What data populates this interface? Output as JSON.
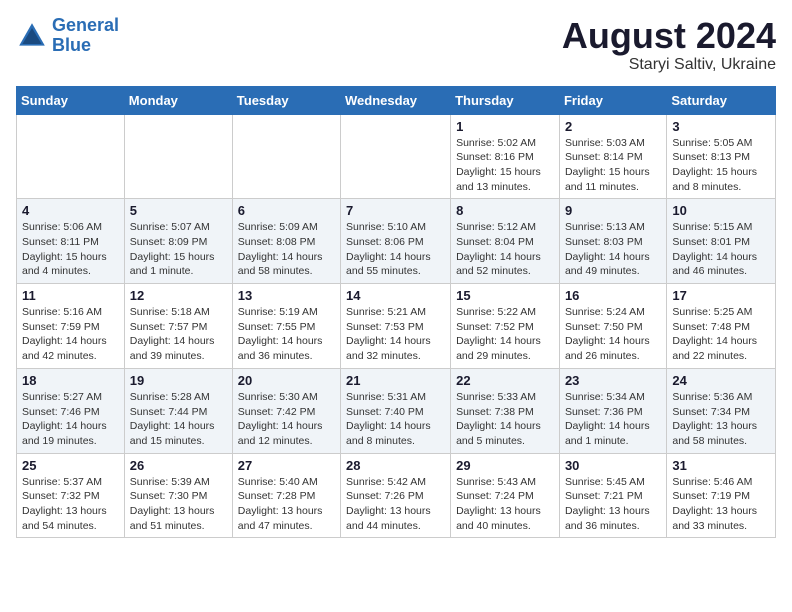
{
  "header": {
    "logo_line1": "General",
    "logo_line2": "Blue",
    "month": "August 2024",
    "location": "Staryi Saltiv, Ukraine"
  },
  "weekdays": [
    "Sunday",
    "Monday",
    "Tuesday",
    "Wednesday",
    "Thursday",
    "Friday",
    "Saturday"
  ],
  "weeks": [
    [
      {
        "day": "",
        "info": ""
      },
      {
        "day": "",
        "info": ""
      },
      {
        "day": "",
        "info": ""
      },
      {
        "day": "",
        "info": ""
      },
      {
        "day": "1",
        "info": "Sunrise: 5:02 AM\nSunset: 8:16 PM\nDaylight: 15 hours\nand 13 minutes."
      },
      {
        "day": "2",
        "info": "Sunrise: 5:03 AM\nSunset: 8:14 PM\nDaylight: 15 hours\nand 11 minutes."
      },
      {
        "day": "3",
        "info": "Sunrise: 5:05 AM\nSunset: 8:13 PM\nDaylight: 15 hours\nand 8 minutes."
      }
    ],
    [
      {
        "day": "4",
        "info": "Sunrise: 5:06 AM\nSunset: 8:11 PM\nDaylight: 15 hours\nand 4 minutes."
      },
      {
        "day": "5",
        "info": "Sunrise: 5:07 AM\nSunset: 8:09 PM\nDaylight: 15 hours\nand 1 minute."
      },
      {
        "day": "6",
        "info": "Sunrise: 5:09 AM\nSunset: 8:08 PM\nDaylight: 14 hours\nand 58 minutes."
      },
      {
        "day": "7",
        "info": "Sunrise: 5:10 AM\nSunset: 8:06 PM\nDaylight: 14 hours\nand 55 minutes."
      },
      {
        "day": "8",
        "info": "Sunrise: 5:12 AM\nSunset: 8:04 PM\nDaylight: 14 hours\nand 52 minutes."
      },
      {
        "day": "9",
        "info": "Sunrise: 5:13 AM\nSunset: 8:03 PM\nDaylight: 14 hours\nand 49 minutes."
      },
      {
        "day": "10",
        "info": "Sunrise: 5:15 AM\nSunset: 8:01 PM\nDaylight: 14 hours\nand 46 minutes."
      }
    ],
    [
      {
        "day": "11",
        "info": "Sunrise: 5:16 AM\nSunset: 7:59 PM\nDaylight: 14 hours\nand 42 minutes."
      },
      {
        "day": "12",
        "info": "Sunrise: 5:18 AM\nSunset: 7:57 PM\nDaylight: 14 hours\nand 39 minutes."
      },
      {
        "day": "13",
        "info": "Sunrise: 5:19 AM\nSunset: 7:55 PM\nDaylight: 14 hours\nand 36 minutes."
      },
      {
        "day": "14",
        "info": "Sunrise: 5:21 AM\nSunset: 7:53 PM\nDaylight: 14 hours\nand 32 minutes."
      },
      {
        "day": "15",
        "info": "Sunrise: 5:22 AM\nSunset: 7:52 PM\nDaylight: 14 hours\nand 29 minutes."
      },
      {
        "day": "16",
        "info": "Sunrise: 5:24 AM\nSunset: 7:50 PM\nDaylight: 14 hours\nand 26 minutes."
      },
      {
        "day": "17",
        "info": "Sunrise: 5:25 AM\nSunset: 7:48 PM\nDaylight: 14 hours\nand 22 minutes."
      }
    ],
    [
      {
        "day": "18",
        "info": "Sunrise: 5:27 AM\nSunset: 7:46 PM\nDaylight: 14 hours\nand 19 minutes."
      },
      {
        "day": "19",
        "info": "Sunrise: 5:28 AM\nSunset: 7:44 PM\nDaylight: 14 hours\nand 15 minutes."
      },
      {
        "day": "20",
        "info": "Sunrise: 5:30 AM\nSunset: 7:42 PM\nDaylight: 14 hours\nand 12 minutes."
      },
      {
        "day": "21",
        "info": "Sunrise: 5:31 AM\nSunset: 7:40 PM\nDaylight: 14 hours\nand 8 minutes."
      },
      {
        "day": "22",
        "info": "Sunrise: 5:33 AM\nSunset: 7:38 PM\nDaylight: 14 hours\nand 5 minutes."
      },
      {
        "day": "23",
        "info": "Sunrise: 5:34 AM\nSunset: 7:36 PM\nDaylight: 14 hours\nand 1 minute."
      },
      {
        "day": "24",
        "info": "Sunrise: 5:36 AM\nSunset: 7:34 PM\nDaylight: 13 hours\nand 58 minutes."
      }
    ],
    [
      {
        "day": "25",
        "info": "Sunrise: 5:37 AM\nSunset: 7:32 PM\nDaylight: 13 hours\nand 54 minutes."
      },
      {
        "day": "26",
        "info": "Sunrise: 5:39 AM\nSunset: 7:30 PM\nDaylight: 13 hours\nand 51 minutes."
      },
      {
        "day": "27",
        "info": "Sunrise: 5:40 AM\nSunset: 7:28 PM\nDaylight: 13 hours\nand 47 minutes."
      },
      {
        "day": "28",
        "info": "Sunrise: 5:42 AM\nSunset: 7:26 PM\nDaylight: 13 hours\nand 44 minutes."
      },
      {
        "day": "29",
        "info": "Sunrise: 5:43 AM\nSunset: 7:24 PM\nDaylight: 13 hours\nand 40 minutes."
      },
      {
        "day": "30",
        "info": "Sunrise: 5:45 AM\nSunset: 7:21 PM\nDaylight: 13 hours\nand 36 minutes."
      },
      {
        "day": "31",
        "info": "Sunrise: 5:46 AM\nSunset: 7:19 PM\nDaylight: 13 hours\nand 33 minutes."
      }
    ]
  ]
}
